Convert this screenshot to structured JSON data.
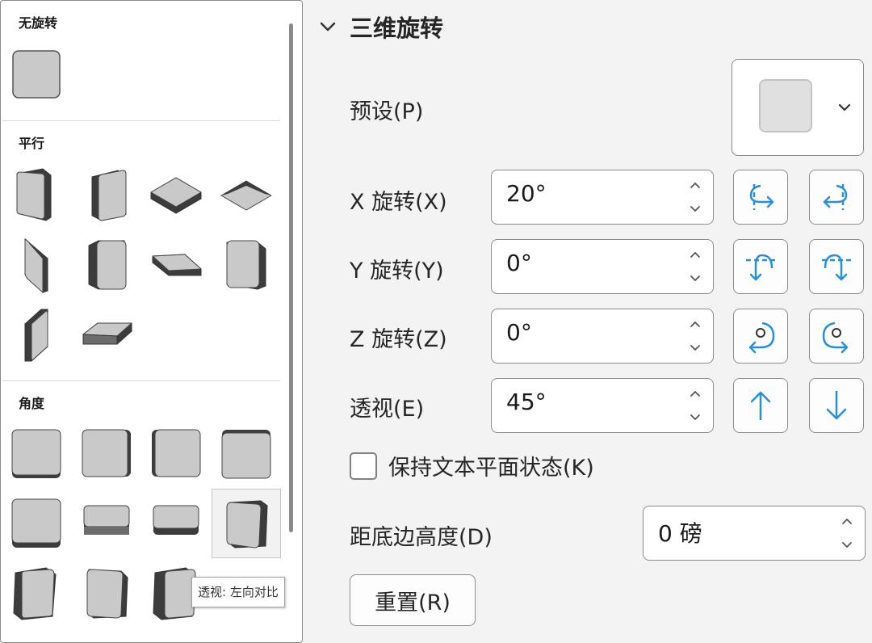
{
  "gallery": {
    "sections": [
      {
        "title": "无旋转"
      },
      {
        "title": "平行"
      },
      {
        "title": "角度"
      }
    ],
    "tooltip": "透视: 左向对比"
  },
  "panel": {
    "title": "三维旋转",
    "preset_label": "预设(P)",
    "x_label": "X 旋转(X)",
    "x_value": "20°",
    "y_label": "Y 旋转(Y)",
    "y_value": "0°",
    "z_label": "Z 旋转(Z)",
    "z_value": "0°",
    "persp_label": "透视(E)",
    "persp_value": "45°",
    "keep_flat_label": "保持文本平面状态(K)",
    "distance_label": "距底边高度(D)",
    "distance_value": "0 磅",
    "reset_label": "重置(R)"
  },
  "colors": {
    "icon_blue": "#2b8fd6",
    "face": "#c9c9c9",
    "side": "#3c3c3c"
  },
  "icons": [
    "chevron-down-icon",
    "rotate-left-icon",
    "rotate-right-icon",
    "rotate-up-icon",
    "rotate-down-icon",
    "rotate-clockwise-icon",
    "rotate-counterclockwise-icon",
    "arrow-up-icon",
    "arrow-down-icon"
  ]
}
